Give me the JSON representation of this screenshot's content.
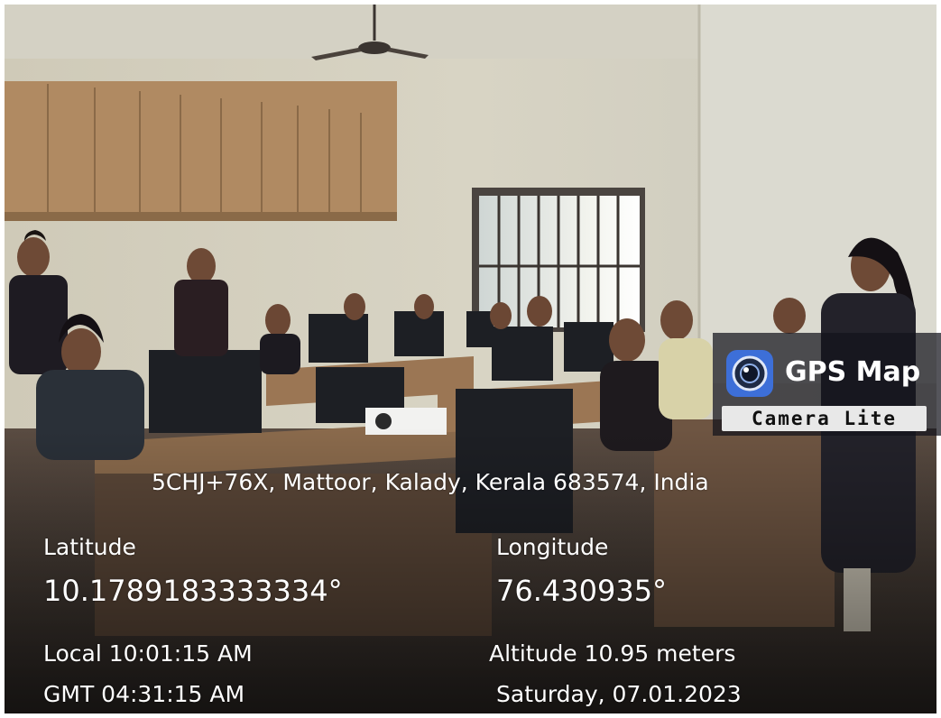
{
  "overlay": {
    "address": "5CHJ+76X, Mattoor, Kalady, Kerala 683574, India",
    "latitude_label": "Latitude",
    "latitude_value": "10.1789183333334°",
    "longitude_label": "Longitude",
    "longitude_value": "76.430935°",
    "local_time": "Local 10:01:15 AM",
    "gmt_time": "GMT 04:31:15 AM",
    "altitude": "Altitude 10.95 meters",
    "date": "Saturday, 07.01.2023"
  },
  "watermark": {
    "title": "GPS Map",
    "subtitle": "Camera Lite",
    "icon": "camera-lens-icon"
  },
  "colors": {
    "overlay_text": "#ffffff",
    "watermark_bg": "#14141c",
    "watermark_sub_bg": "#e8e8e8",
    "icon_accent": "#3d6fd8"
  }
}
